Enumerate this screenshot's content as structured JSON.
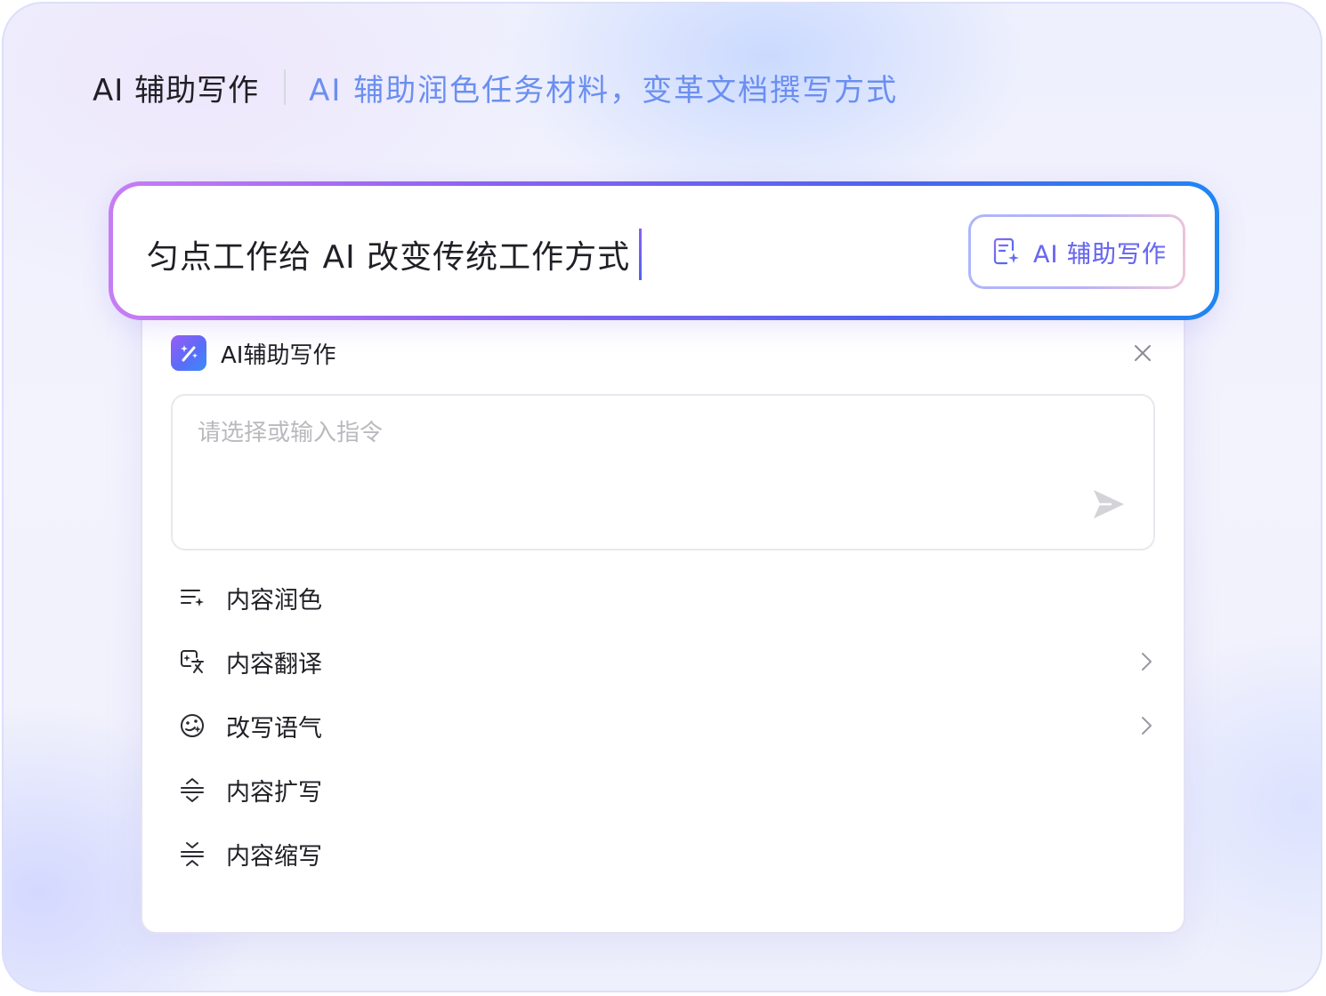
{
  "header": {
    "title": "AI 辅助写作",
    "subtitle": "AI 辅助润色任务材料，变革文档撰写方式"
  },
  "editor": {
    "text": "匀点工作给 AI 改变传统工作方式",
    "ai_button_label": "AI 辅助写作",
    "ai_button_icon": "document-sparkle-icon"
  },
  "panel": {
    "title": "AI辅助写作",
    "logo_icon": "magic-wand-icon",
    "close_icon": "close-icon",
    "command_placeholder": "请选择或输入指令",
    "send_icon": "send-icon",
    "menu": [
      {
        "label": "内容润色",
        "icon": "polish-icon",
        "has_submenu": false
      },
      {
        "label": "内容翻译",
        "icon": "translate-icon",
        "has_submenu": true
      },
      {
        "label": "改写语气",
        "icon": "tone-icon",
        "has_submenu": true
      },
      {
        "label": "内容扩写",
        "icon": "expand-icon",
        "has_submenu": false
      },
      {
        "label": "内容缩写",
        "icon": "condense-icon",
        "has_submenu": false
      }
    ]
  },
  "colors": {
    "subtitle": "#6b8ff0",
    "gradient_start": "#c77df3",
    "gradient_end": "#1e86f3",
    "text_primary": "#1f1f25",
    "placeholder": "#b9b9be"
  }
}
